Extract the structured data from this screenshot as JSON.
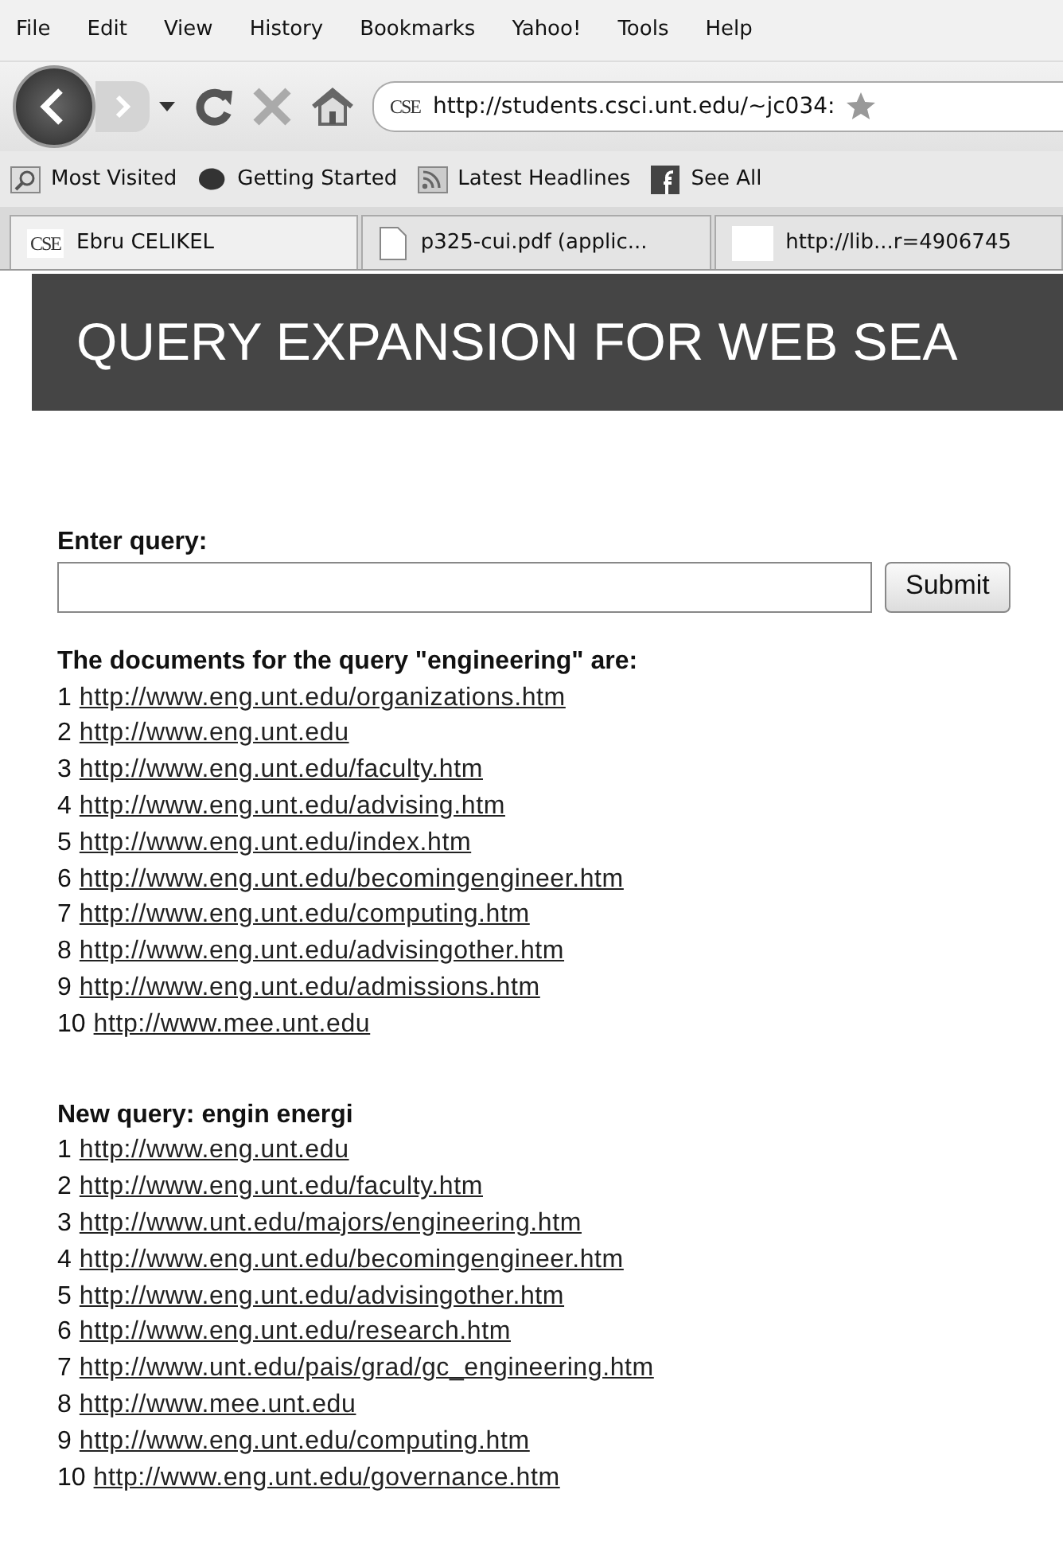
{
  "menu": [
    "File",
    "Edit",
    "View",
    "History",
    "Bookmarks",
    "Yahoo!",
    "Tools",
    "Help"
  ],
  "address_bar": {
    "site_badge": "CSE",
    "url": "http://students.csci.unt.edu/~jc034:"
  },
  "bookmarks": [
    "Most Visited",
    "Getting Started",
    "Latest Headlines",
    "See All"
  ],
  "tabs": [
    {
      "label": "Ebru CELIKEL",
      "badge": "CSE",
      "selected": true
    },
    {
      "label": "p325-cui.pdf (applic...",
      "selected": false
    },
    {
      "label": "http://lib...r=4906745",
      "selected": false
    }
  ],
  "banner": {
    "title": "QUERY EXPANSION FOR WEB SEA"
  },
  "form": {
    "label": "Enter query:",
    "button": "Submit"
  },
  "results": [
    {
      "heading": "The documents for the query \"engineering\" are:",
      "items": [
        {
          "number": "1",
          "url": "http://www.eng.unt.edu/organizations.htm"
        },
        {
          "number": "2",
          "url": "http://www.eng.unt.edu"
        },
        {
          "number": "3",
          "url": "http://www.eng.unt.edu/faculty.htm"
        },
        {
          "number": "4",
          "url": "http://www.eng.unt.edu/advising.htm"
        },
        {
          "number": "5",
          "url": "http://www.eng.unt.edu/index.htm"
        },
        {
          "number": "6",
          "url": "http://www.eng.unt.edu/becomingengineer.htm"
        },
        {
          "number": "7",
          "url": "http://www.eng.unt.edu/computing.htm"
        },
        {
          "number": "8",
          "url": "http://www.eng.unt.edu/advisingother.htm"
        },
        {
          "number": "9",
          "url": "http://www.eng.unt.edu/admissions.htm"
        },
        {
          "number": "10",
          "url": "http://www.mee.unt.edu"
        }
      ]
    },
    {
      "heading": "New query: engin energi",
      "items": [
        {
          "number": "1",
          "url": "http://www.eng.unt.edu"
        },
        {
          "number": "2",
          "url": "http://www.eng.unt.edu/faculty.htm"
        },
        {
          "number": "3",
          "url": "http://www.unt.edu/majors/engineering.htm"
        },
        {
          "number": "4",
          "url": "http://www.eng.unt.edu/becomingengineer.htm"
        },
        {
          "number": "5",
          "url": "http://www.eng.unt.edu/advisingother.htm"
        },
        {
          "number": "6",
          "url": "http://www.eng.unt.edu/research.htm"
        },
        {
          "number": "7",
          "url": "http://www.unt.edu/pais/grad/gc_engineering.htm"
        },
        {
          "number": "8",
          "url": "http://www.mee.unt.edu"
        },
        {
          "number": "9",
          "url": "http://www.eng.unt.edu/computing.htm"
        },
        {
          "number": "10",
          "url": "http://www.eng.unt.edu/governance.htm"
        }
      ]
    }
  ]
}
